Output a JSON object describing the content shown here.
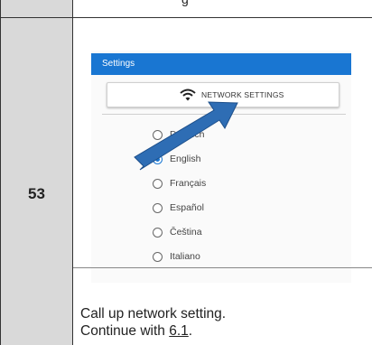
{
  "top_strip": {
    "text": "g"
  },
  "step": {
    "number": "53"
  },
  "app": {
    "title": "Settings",
    "network_button": {
      "label": "NETWORK SETTINGS",
      "icon": "wifi-icon"
    },
    "languages": [
      {
        "label": "Deutsch",
        "checked": false
      },
      {
        "label": "English",
        "checked": true
      },
      {
        "label": "Français",
        "checked": false
      },
      {
        "label": "Español",
        "checked": false
      },
      {
        "label": "Čeština",
        "checked": false
      },
      {
        "label": "Italiano",
        "checked": false
      }
    ],
    "accent_color": "#1976d2",
    "arrow_color": "#2e6db4"
  },
  "caption": {
    "line1": "Call up network setting.",
    "line2_prefix": "Continue with ",
    "line2_link": "6.1",
    "line2_suffix": "."
  }
}
